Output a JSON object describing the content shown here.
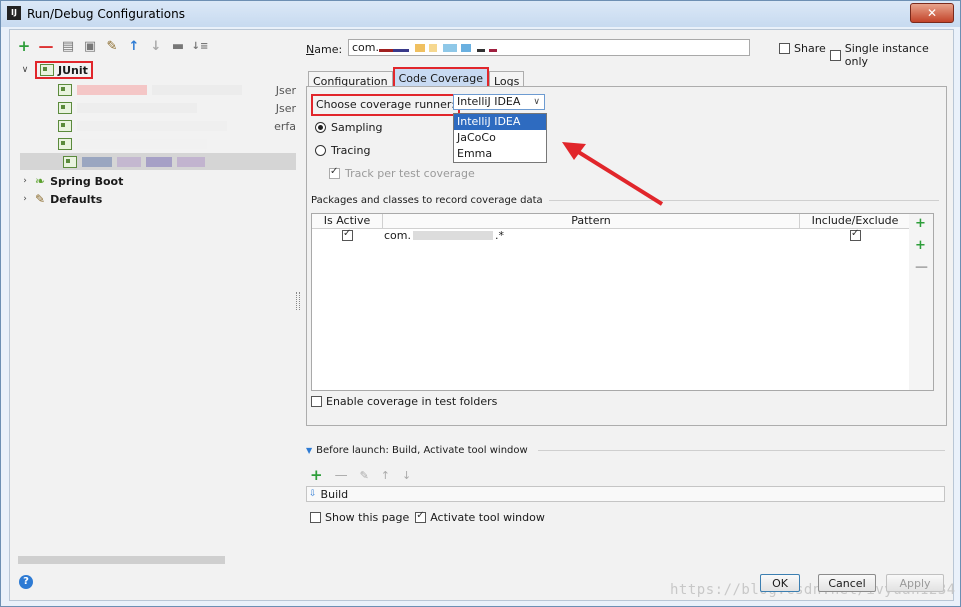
{
  "window": {
    "title": "Run/Debug Configurations",
    "app_icon": "IJ",
    "close_glyph": "✕"
  },
  "left": {
    "toolbar": [
      "add-icon",
      "remove-icon",
      "copy-icon",
      "save-icon",
      "wrench-icon",
      "move-up-icon",
      "move-down-icon",
      "folder-icon",
      "sort-icon"
    ],
    "tree": {
      "junit": "JUnit",
      "child_suffixes": [
        "Jser",
        "Jser",
        "erfa",
        "",
        ""
      ],
      "spring_boot": "Spring Boot",
      "defaults": "Defaults"
    },
    "help_glyph": "?"
  },
  "right": {
    "name_label": "Name:",
    "name_value": "com.",
    "share_label": "Share",
    "single_instance_label": "Single instance only",
    "tabs": [
      "Configuration",
      "Code Coverage",
      "Logs"
    ],
    "runner_label": "Choose coverage runner:",
    "runner_value": "IntelliJ IDEA",
    "runner_options": [
      "IntelliJ IDEA",
      "JaCoCo",
      "Emma"
    ],
    "sampling": "Sampling",
    "tracing": "Tracing",
    "track_per_test": "Track per test coverage",
    "packages_group": "Packages and classes to record coverage data",
    "table": {
      "headers": [
        "Is Active",
        "Pattern",
        "Include/Exclude"
      ],
      "rows": [
        {
          "active": true,
          "pattern_prefix": "com.",
          "pattern_suffix": ".*",
          "include": true
        }
      ]
    },
    "enable_test_folders": "Enable coverage in test folders",
    "before_launch": "Before launch: Build, Activate tool window",
    "build_item": "Build",
    "show_page": "Show this page",
    "activate_tool": "Activate tool window"
  },
  "buttons": {
    "ok": "OK",
    "cancel": "Cancel",
    "apply": "Apply"
  },
  "watermark": "https://blog.csdn.net/ivyuan1234",
  "colors": {
    "accent": "#2e6bc0",
    "highlight": "#e1262b",
    "add_green": "#2e9e3a"
  }
}
